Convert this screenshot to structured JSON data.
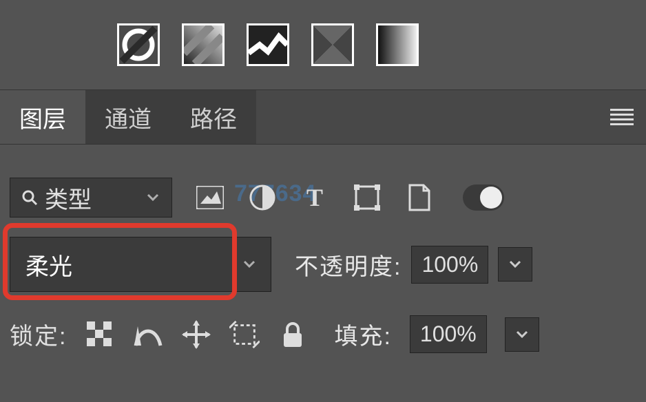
{
  "tabs": {
    "layers": "图层",
    "channels": "通道",
    "paths": "路径"
  },
  "kind": {
    "label": "类型"
  },
  "blend": {
    "mode": "柔光"
  },
  "opacity": {
    "label": "不透明度:",
    "value": "100%"
  },
  "lock": {
    "label": "锁定:"
  },
  "fill": {
    "label": "填充:",
    "value": "100%"
  },
  "watermark": "777634"
}
